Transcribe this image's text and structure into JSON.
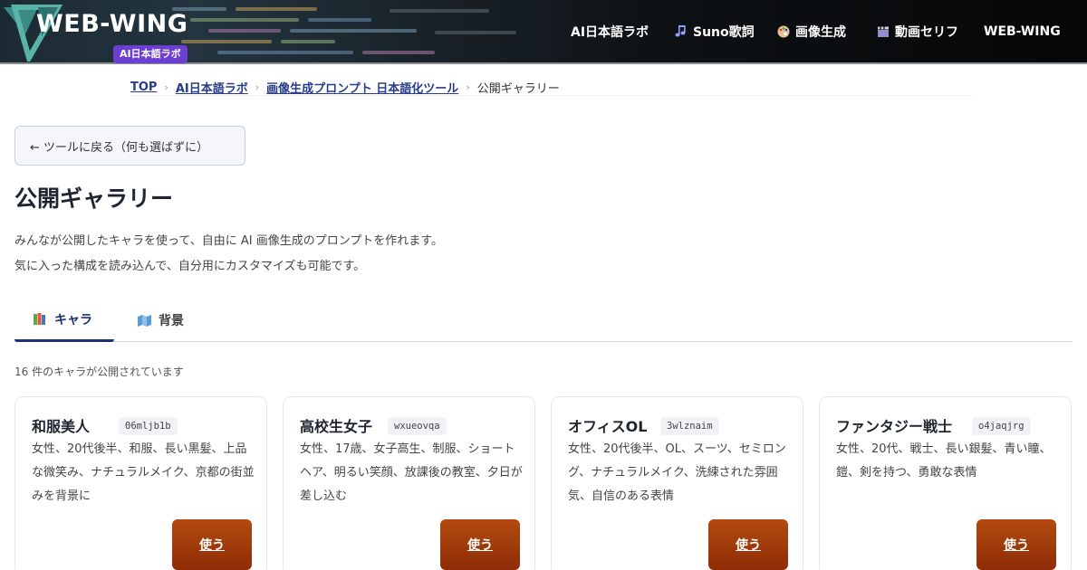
{
  "header": {
    "logo_text": "WEB-WING",
    "logo_badge": "AI日本語ラボ",
    "nav": [
      {
        "label": "AI日本語ラボ",
        "icon": ""
      },
      {
        "label": "Suno歌詞",
        "icon": "music-note-icon"
      },
      {
        "label": "画像生成",
        "icon": "palette-icon"
      },
      {
        "label": "動画セリフ",
        "icon": "clapperboard-icon"
      },
      {
        "label": "WEB-WING",
        "icon": ""
      }
    ]
  },
  "breadcrumb": {
    "items": [
      "TOP",
      "AI日本語ラボ",
      "画像生成プロンプト 日本語化ツール"
    ],
    "separator": "›",
    "current": "公開ギャラリー"
  },
  "back_button": "← ツールに戻る（何も選ばずに）",
  "page": {
    "title": "公開ギャラリー",
    "description": [
      "みんなが公開したキャラを使って、自由に AI 画像生成のプロンプトを作れます。",
      "気に入った構成を読み込んで、自分用にカスタマイズも可能です。"
    ]
  },
  "tabs": [
    {
      "label": "キャラ",
      "icon": "books-icon",
      "active": true
    },
    {
      "label": "背景",
      "icon": "map-icon",
      "active": false
    }
  ],
  "count_text": "16 件のキャラが公開されています",
  "cards": [
    {
      "name": "和服美人",
      "id": "06mljb1b",
      "desc": "女性、20代後半、和服、長い黒髪、上品な微笑み、ナチュラルメイク、京都の街並みを背景に",
      "button": "使う"
    },
    {
      "name": "高校生女子",
      "id": "wxueovqa",
      "desc": "女性、17歳、女子高生、制服、ショートヘア、明るい笑顔、放課後の教室、夕日が差し込む",
      "button": "使う"
    },
    {
      "name": "オフィスOL",
      "id": "3wlznaim",
      "desc": "女性、20代後半、OL、スーツ、セミロング、ナチュラルメイク、洗練された雰囲気、自信のある表情",
      "button": "使う"
    },
    {
      "name": "ファンタジー戦士",
      "id": "o4jaqjrg",
      "desc": "女性、20代、戦士、長い銀髪、青い瞳、鎧、剣を持つ、勇敢な表情",
      "button": "使う"
    }
  ],
  "colors": {
    "accent": "#1e3273",
    "button": "#a33d0c",
    "badge": "#6d3fd0"
  }
}
